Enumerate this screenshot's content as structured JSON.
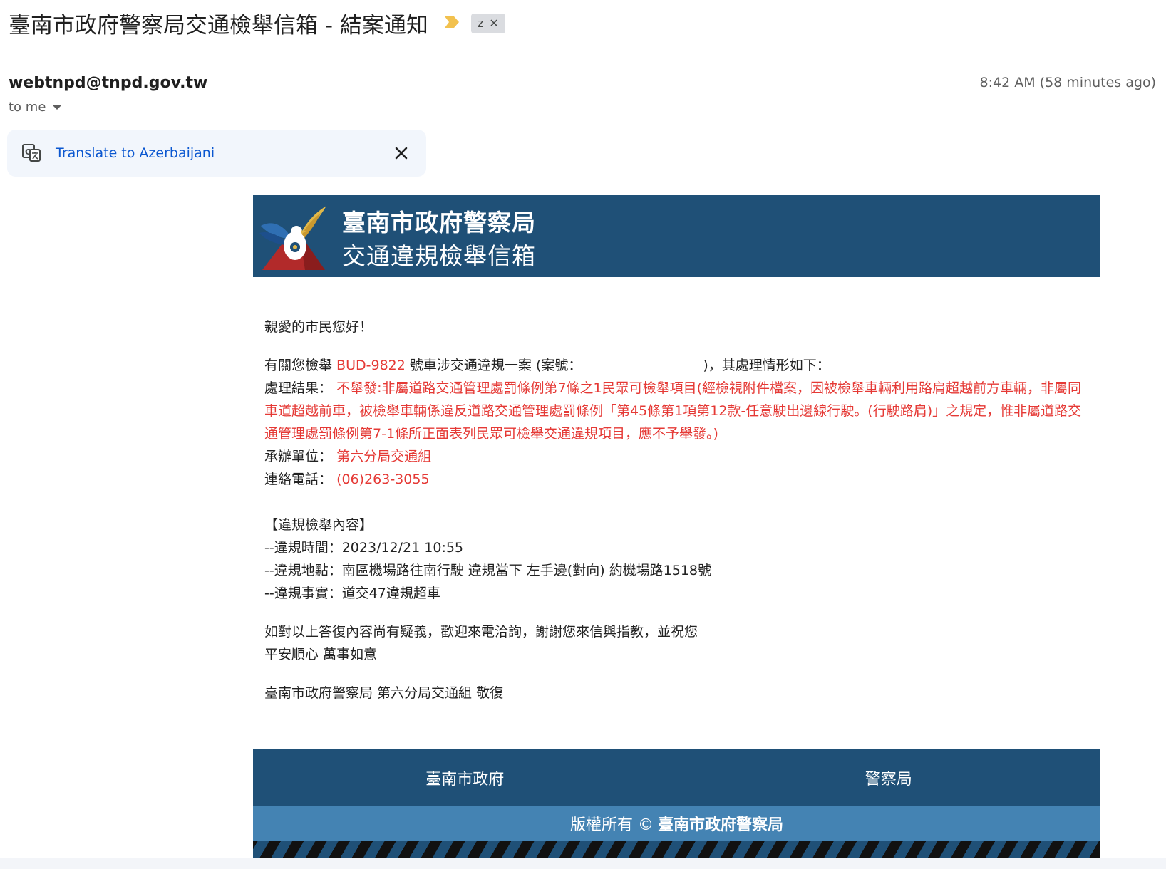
{
  "email": {
    "subject": "臺南市政府警察局交通檢舉信箱 - 結案通知",
    "label": "z",
    "sender": "webtnpd@tnpd.gov.tw",
    "recipient": "to me",
    "timestamp": "8:42 AM (58 minutes ago)"
  },
  "translate": {
    "link": "Translate to Azerbaijani"
  },
  "banner": {
    "title": "臺南市政府警察局",
    "subtitle": "交通違規檢舉信箱"
  },
  "body": {
    "greeting": "親愛的市民您好！",
    "intro_prefix": "有關您檢舉 ",
    "plate": "BUD-9822",
    "intro_middle": " 號車涉交通違規一案 (案號：",
    "intro_suffix": ")，其處理情形如下：",
    "result_label": "處理結果：",
    "result_text": "不舉發:非屬道路交通管理處罰條例第7條之1民眾可檢舉項目(經檢視附件檔案，因被檢舉車輛利用路肩超越前方車輛，非屬同車道超越前車，被檢舉車輛係違反道路交通管理處罰條例「第45條第1項第12款-任意駛出邊線行駛。(行駛路肩)」之規定，惟非屬道路交通管理處罰條例第7-1條所正面表列民眾可檢舉交通違規項目，應不予舉發。)",
    "unit_label": "承辦單位：",
    "unit": "第六分局交通組",
    "phone_label": "連絡電話：",
    "phone": "(06)263-3055",
    "violation_heading": "【違規檢舉內容】",
    "violation_time": "--違規時間：2023/12/21 10:55",
    "violation_place": "--違規地點：南區機場路往南行駛 違規當下 左手邊(對向) 約機場路1518號",
    "violation_fact": "--違規事實：道交47違規超車",
    "closing_line1": "如對以上答復內容尚有疑義，歡迎來電洽詢，謝謝您來信與指教，並祝您",
    "closing_line2": "平安順心 萬事如意",
    "signature": "臺南市政府警察局 第六分局交通組 敬復"
  },
  "footer": {
    "link_city": "臺南市政府",
    "link_police": "警察局",
    "copyright_prefix": "版權所有 ©",
    "copyright_org": "臺南市政府警察局"
  },
  "colors": {
    "banner": "#1f5077",
    "copyright_bar": "#4483b3",
    "highlight_red": "#e53935",
    "link_blue": "#0b57d0",
    "important_marker": "#f2c14e"
  }
}
